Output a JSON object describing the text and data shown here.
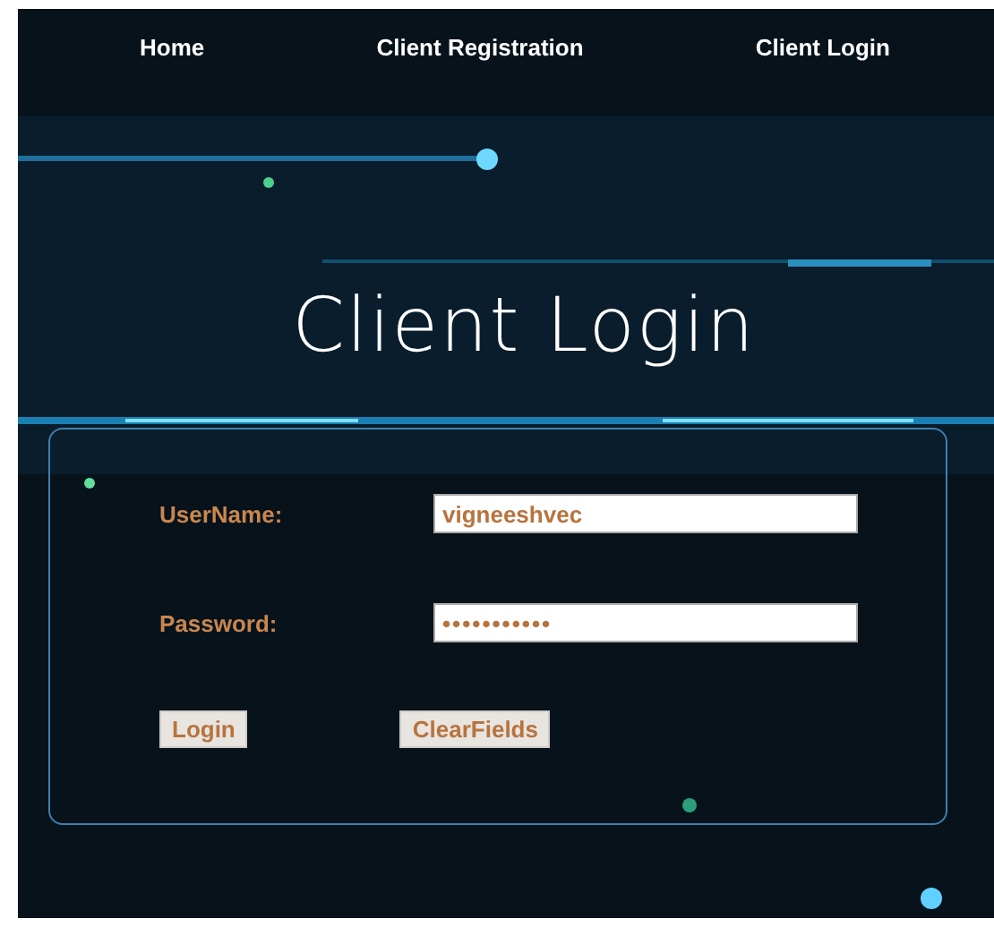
{
  "nav": [
    {
      "label": "Home"
    },
    {
      "label": "Client Registration"
    },
    {
      "label": "Client Login"
    }
  ],
  "title": "Client Login",
  "form": {
    "fields": [
      {
        "label": "UserName:",
        "value": "vigneeshvec",
        "kind": "text"
      },
      {
        "label": "Password:",
        "value": "•••••••••••",
        "kind": "password"
      }
    ],
    "buttons": [
      "Login",
      "ClearFields"
    ]
  }
}
